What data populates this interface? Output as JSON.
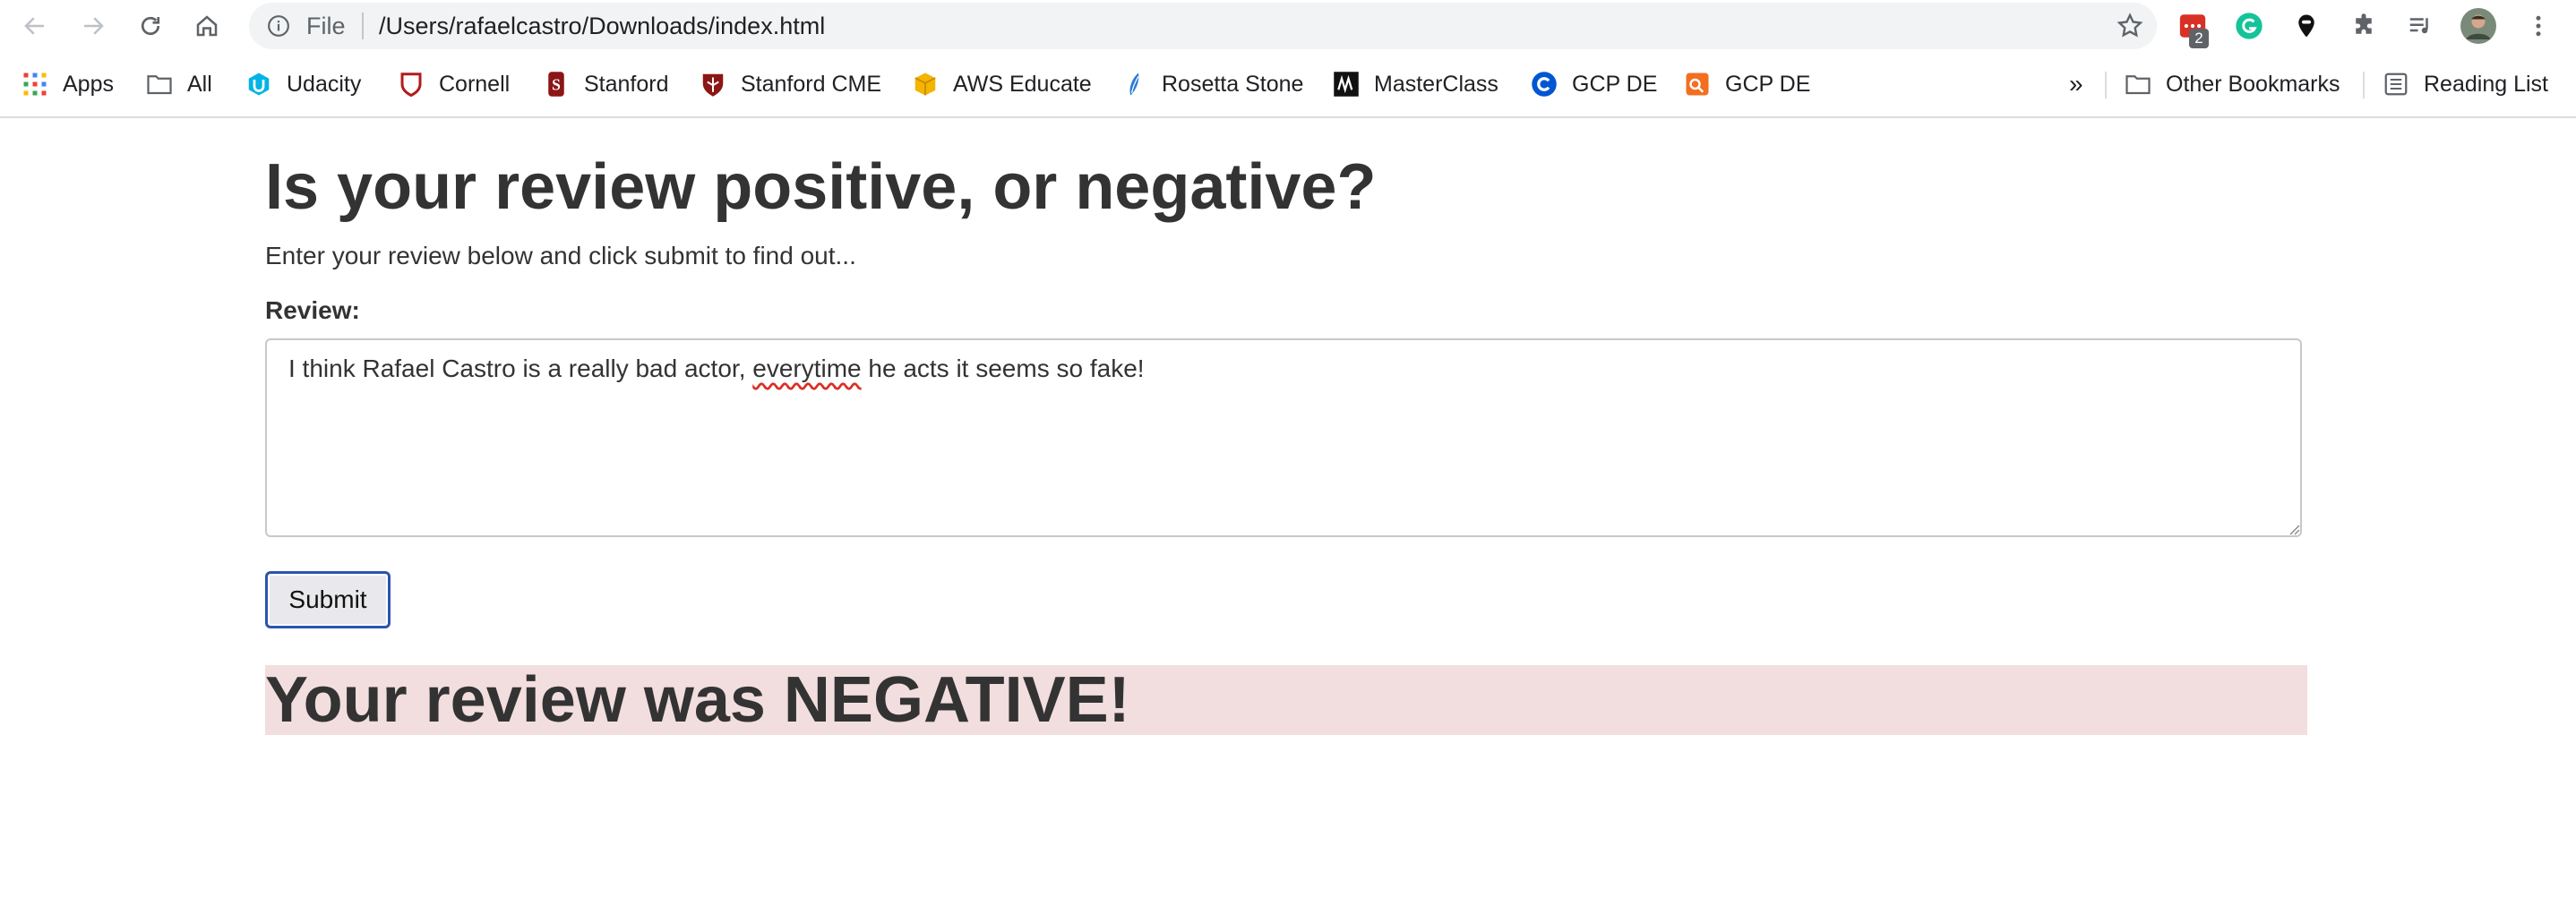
{
  "browser": {
    "url_scheme": "File",
    "url": "/Users/rafaelcastro/Downloads/index.html",
    "extension_badge": "2"
  },
  "bookmarks": {
    "items": [
      {
        "label": "Apps",
        "icon": "apps-grid-icon"
      },
      {
        "label": "All",
        "icon": "folder-icon"
      },
      {
        "label": "Udacity",
        "icon": "udacity-icon"
      },
      {
        "label": "Cornell",
        "icon": "cornell-shield-icon"
      },
      {
        "label": "Stanford",
        "icon": "stanford-icon"
      },
      {
        "label": "Stanford CME",
        "icon": "stanford-shield-icon"
      },
      {
        "label": "AWS Educate",
        "icon": "aws-box-icon"
      },
      {
        "label": "Rosetta Stone",
        "icon": "rosetta-icon"
      },
      {
        "label": "MasterClass",
        "icon": "masterclass-icon"
      },
      {
        "label": "GCP DE",
        "icon": "coursera-icon"
      },
      {
        "label": "GCP DE",
        "icon": "qwiklabs-icon"
      }
    ],
    "overflow": "»",
    "other": "Other Bookmarks",
    "reading_list": "Reading List"
  },
  "page": {
    "title": "Is your review positive, or negative?",
    "subtitle": "Enter your review below and click submit to find out...",
    "review_label": "Review:",
    "review_text_before": "I think Rafael Castro is a really bad actor, ",
    "review_text_misspelled": "everytime",
    "review_text_after": " he acts it seems so fake!",
    "submit_label": "Submit",
    "result": "Your review was NEGATIVE!"
  },
  "colors": {
    "result_background": "#f2dede",
    "button_focus_border": "#2a54b0"
  }
}
